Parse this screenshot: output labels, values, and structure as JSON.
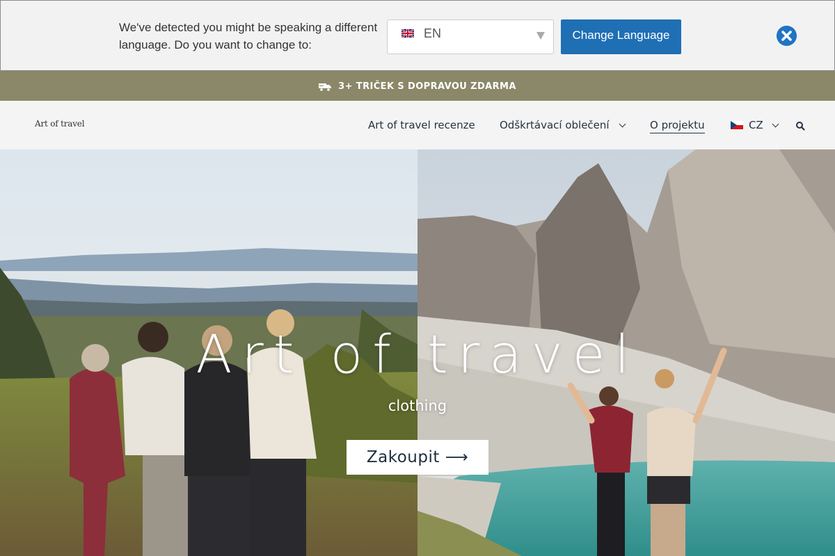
{
  "language_banner": {
    "message": "We've detected you might be speaking a different language. Do you want to change to:",
    "selected_language": "EN",
    "change_button": "Change Language"
  },
  "promo": {
    "text": "3+ TRIČEK S DOPRAVOU ZDARMA"
  },
  "header": {
    "logo": "Art of travel",
    "nav": [
      {
        "label": "Art of travel recenze"
      },
      {
        "label": "Odškrtávací oblečení"
      },
      {
        "label": "O projektu"
      },
      {
        "label": "CZ"
      }
    ]
  },
  "hero": {
    "title": "Art of travel",
    "subtitle": "clothing",
    "cta": "Zakoupit ⟶"
  },
  "colors": {
    "banner_bg": "#f2f2f2",
    "button_blue": "#1f6fb5",
    "promo_bg": "#8a8868",
    "header_bg": "#f4f4f4",
    "nav_text": "#253340"
  }
}
